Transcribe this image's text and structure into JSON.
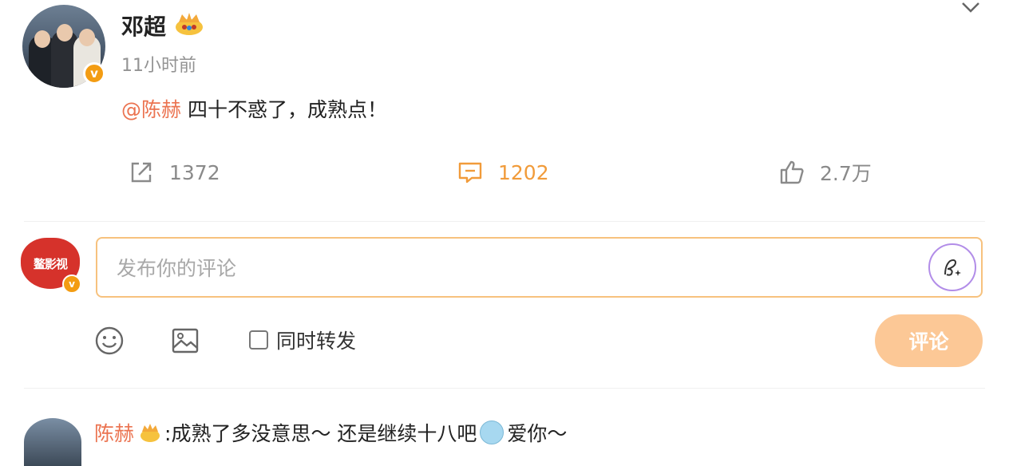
{
  "post": {
    "author": "邓超",
    "time": "11小时前",
    "mention": "@陈赫",
    "text": " 四十不惑了，成熟点！"
  },
  "actions": {
    "repost_count": "1372",
    "comment_count": "1202",
    "like_count": "2.7万"
  },
  "composer": {
    "avatar_text": "鳌影视",
    "placeholder": "发布你的评论",
    "repost_label": "同时转发",
    "submit_label": "评论"
  },
  "reply": {
    "author": "陈赫",
    "text_before": ":成熟了多没意思～ 还是继续十八吧",
    "text_after": " 爱你～"
  },
  "colors": {
    "accent": "#f19b3a",
    "mention": "#eb7350",
    "input_border": "#f7c27e",
    "submit_bg": "#fcc896",
    "badge": "#f39c12"
  }
}
